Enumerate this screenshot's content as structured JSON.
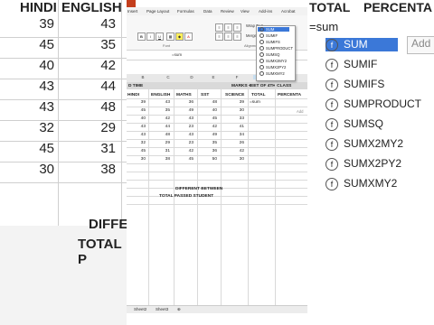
{
  "left_zoom": {
    "headers": [
      "HINDI",
      "ENGLISH"
    ],
    "rows": [
      [
        "39",
        "43"
      ],
      [
        "45",
        "35"
      ],
      [
        "40",
        "42"
      ],
      [
        "43",
        "44"
      ],
      [
        "43",
        "48"
      ],
      [
        "32",
        "29"
      ],
      [
        "45",
        "31"
      ],
      [
        "30",
        "38"
      ]
    ],
    "diff_labels": [
      "DIFFER",
      "TOTAL P"
    ]
  },
  "right_zoom": {
    "headers": [
      "TOTAL",
      "PERCENTA"
    ],
    "typed": "=sum",
    "add_button": "Add",
    "functions": [
      "SUM",
      "SUMIF",
      "SUMIFS",
      "SUMPRODUCT",
      "SUMSQ",
      "SUMX2MY2",
      "SUMX2PY2",
      "SUMXMY2"
    ]
  },
  "excel": {
    "ribbon_tabs": [
      "Insert",
      "Page Layout",
      "Formulas",
      "Data",
      "Review",
      "View",
      "Add-ins",
      "Acrobat"
    ],
    "ribbon_right": [
      "Wrap Text",
      "Merge & Center"
    ],
    "group_labels": [
      "Font",
      "Alignment"
    ],
    "formula_bar": "=sum",
    "columns": [
      "B",
      "C",
      "D",
      "E",
      "F",
      "G",
      "H"
    ],
    "title_row": [
      "D TIME",
      "MARKSHEET OF 4TH CLASS"
    ],
    "table_headers": [
      "HINDI",
      "ENGLISH",
      "MATHS",
      "SST",
      "SCIENCE",
      "TOTAL",
      "PERCENTA"
    ],
    "rows": [
      [
        "39",
        "43",
        "36",
        "48",
        "39"
      ],
      [
        "45",
        "35",
        "49",
        "40",
        "30"
      ],
      [
        "40",
        "42",
        "43",
        "45",
        "33"
      ],
      [
        "43",
        "44",
        "23",
        "42",
        "41"
      ],
      [
        "43",
        "48",
        "43",
        "49",
        "34"
      ],
      [
        "32",
        "29",
        "23",
        "35",
        "26"
      ],
      [
        "45",
        "31",
        "42",
        "36",
        "42"
      ],
      [
        "30",
        "38",
        "45",
        "50",
        "30"
      ]
    ],
    "active_cell_value": "=sum",
    "popup": [
      "SUM",
      "SUMIF",
      "SUMIFS",
      "SUMPRODUCT",
      "SUMSQ",
      "SUMX2MY2",
      "SUMX2PY2",
      "SUMXMY2"
    ],
    "add_label": "Add",
    "bottom_labels": [
      "DIFFERENT BETWEEN",
      "TOTAL PASSED STUDENT"
    ],
    "sheet_tabs": [
      "Sheet2",
      "Sheet3"
    ]
  }
}
